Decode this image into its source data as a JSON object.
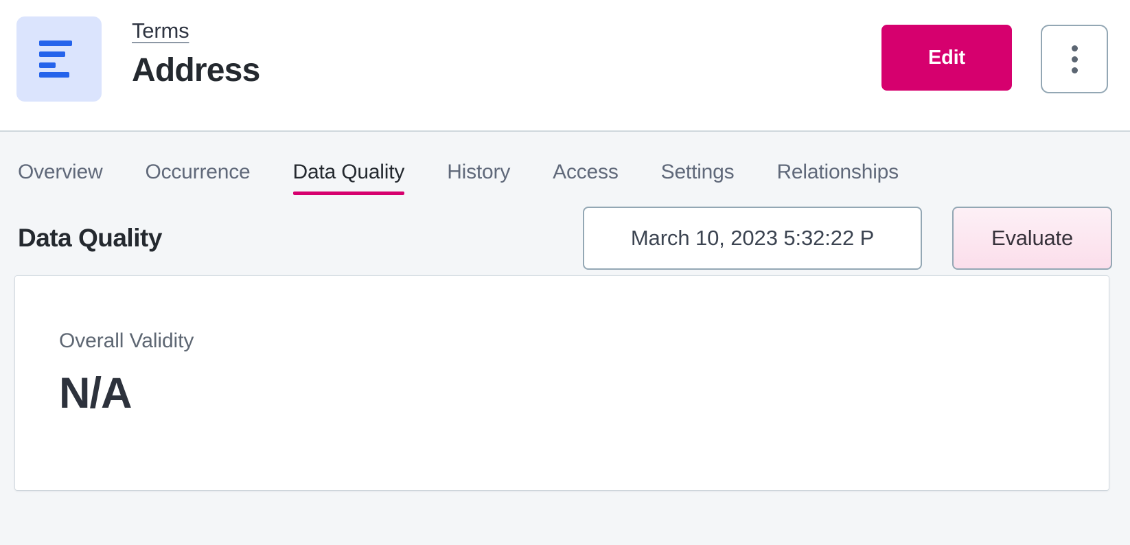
{
  "header": {
    "entity_icon": "list-lines-icon",
    "breadcrumb": "Terms",
    "title": "Address",
    "edit_label": "Edit",
    "more_icon": "kebab-menu-icon",
    "accent_color": "#d6006e",
    "icon_tile_color": "#dbe4fd",
    "icon_glyph_color": "#2563eb"
  },
  "tabs": [
    {
      "label": "Overview",
      "active": false
    },
    {
      "label": "Occurrence",
      "active": false
    },
    {
      "label": "Data Quality",
      "active": true
    },
    {
      "label": "History",
      "active": false
    },
    {
      "label": "Access",
      "active": false
    },
    {
      "label": "Settings",
      "active": false
    },
    {
      "label": "Relationships",
      "active": false
    }
  ],
  "section": {
    "title": "Data Quality",
    "date_select_value": "March 10, 2023 5:32:22 P",
    "evaluate_label": "Evaluate"
  },
  "card": {
    "label": "Overall Validity",
    "value": "N/A"
  }
}
